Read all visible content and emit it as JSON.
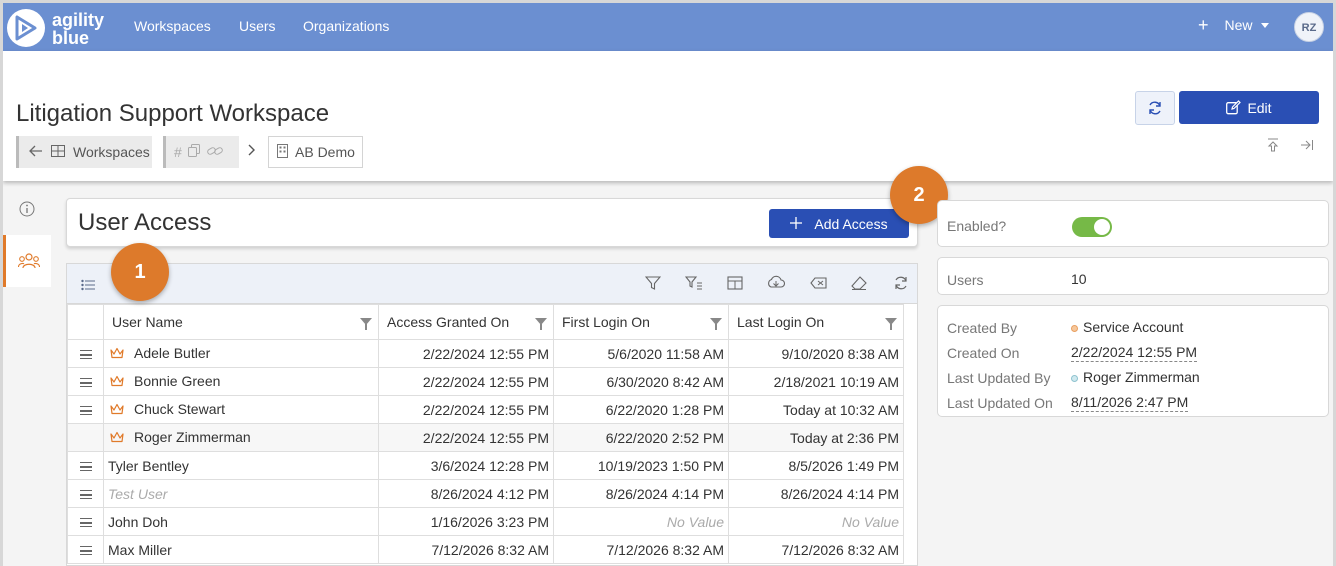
{
  "nav": {
    "brand_line1": "agility",
    "brand_line2": "blue",
    "links": [
      "Workspaces",
      "Users",
      "Organizations"
    ],
    "new_label": "New",
    "avatar_initials": "RZ"
  },
  "header": {
    "title": "Litigation Support Workspace",
    "breadcrumb_back": "Workspaces",
    "breadcrumb_current": "AB Demo",
    "edit_label": "Edit"
  },
  "user_access": {
    "title": "User Access",
    "add_label": "Add Access",
    "markers": [
      "1",
      "2"
    ]
  },
  "table": {
    "columns": [
      "User Name",
      "Access Granted On",
      "First Login On",
      "Last Login On"
    ],
    "rows": [
      {
        "name": "Adele Butler",
        "granted": "2/22/2024 12:55 PM",
        "first": "5/6/2020 11:58 AM",
        "last": "9/10/2020 8:38 AM",
        "owner": true,
        "handle": true
      },
      {
        "name": "Bonnie Green",
        "granted": "2/22/2024 12:55 PM",
        "first": "6/30/2020 8:42 AM",
        "last": "2/18/2021 10:19 AM",
        "owner": true,
        "handle": true
      },
      {
        "name": "Chuck Stewart",
        "granted": "2/22/2024 12:55 PM",
        "first": "6/22/2020 1:28 PM",
        "last": "Today at 10:32 AM",
        "owner": true,
        "handle": true
      },
      {
        "name": "Roger Zimmerman",
        "granted": "2/22/2024 12:55 PM",
        "first": "6/22/2020 2:52 PM",
        "last": "Today at 2:36 PM",
        "owner": true,
        "handle": false
      },
      {
        "name": "Tyler Bentley",
        "granted": "3/6/2024 12:28 PM",
        "first": "10/19/2023 1:50 PM",
        "last": "8/5/2026 1:49 PM",
        "owner": false,
        "handle": true
      },
      {
        "name": "Test User",
        "granted": "8/26/2024 4:12 PM",
        "first": "8/26/2024 4:14 PM",
        "last": "8/26/2024 4:14 PM",
        "owner": false,
        "handle": true,
        "muted_name": true
      },
      {
        "name": "John Doh",
        "granted": "1/16/2026 3:23 PM",
        "first": "No Value",
        "last": "No Value",
        "owner": false,
        "handle": true,
        "muted_dates": true
      },
      {
        "name": "Max Miller",
        "granted": "7/12/2026 8:32 AM",
        "first": "7/12/2026 8:32 AM",
        "last": "7/12/2026 8:32 AM",
        "owner": false,
        "handle": true
      }
    ]
  },
  "details": {
    "enabled_label": "Enabled?",
    "enabled": true,
    "users_label": "Users",
    "users_value": "10",
    "created_by_label": "Created By",
    "created_by_value": "Service Account",
    "created_on_label": "Created On",
    "created_on_value": "2/22/2024 12:55 PM",
    "updated_by_label": "Last Updated By",
    "updated_by_value": "Roger Zimmerman",
    "updated_on_label": "Last Updated On",
    "updated_on_value": "8/11/2026 2:47 PM"
  },
  "colors": {
    "nav": "#6b8fd1",
    "primary_button": "#2a4fb4",
    "marker": "#dd7a2b",
    "toggle_on": "#76b947"
  }
}
